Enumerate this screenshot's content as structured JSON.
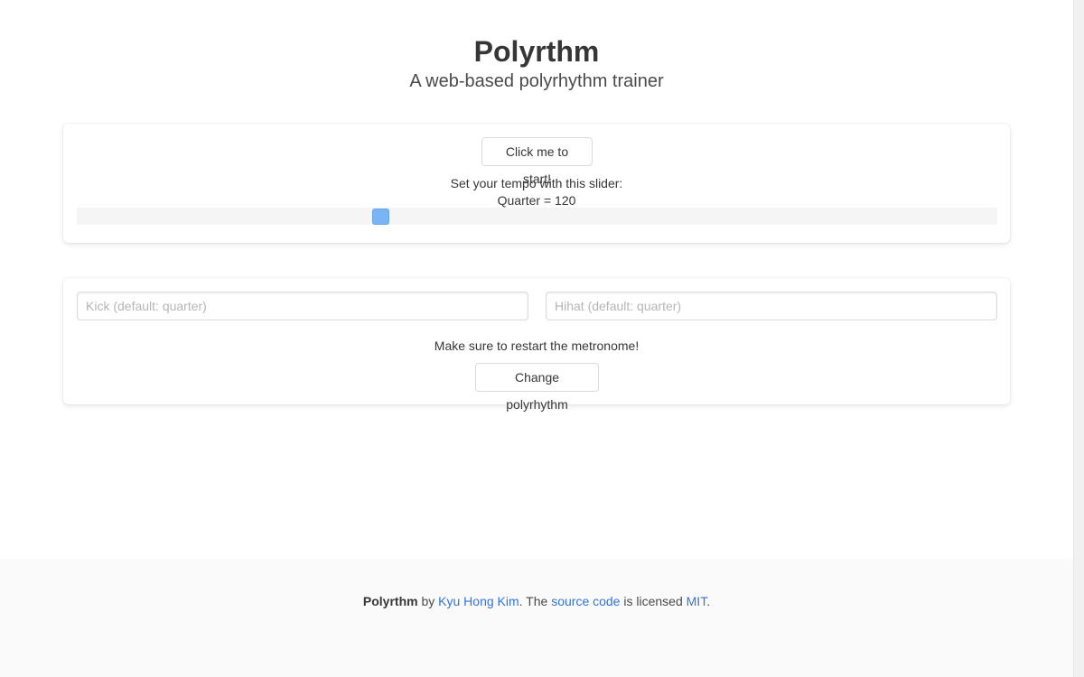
{
  "hero": {
    "title": "Polyrthm",
    "subtitle": "A web-based polyrhythm trainer"
  },
  "tempo_panel": {
    "start_button_label": "Click me to start!",
    "slider_instruction": "Set your tempo with this slider:",
    "tempo_readout": "Quarter = 120",
    "slider_value_fraction": 0.33,
    "slider_thumb_color": "#7ab4f5"
  },
  "rhythm_panel": {
    "kick_placeholder": "Kick (default: quarter)",
    "hihat_placeholder": "Hihat (default: quarter)",
    "restart_note": "Make sure to restart the metronome!",
    "change_button_label": "Change polyrhythm"
  },
  "footer": {
    "app_name": "Polyrthm",
    "by_text": " by ",
    "author_link": "Kyu Hong Kim",
    "mid_text": ". The ",
    "source_link": "source code",
    "licensed_text": " is licensed ",
    "license_link": "MIT",
    "end_text": "."
  },
  "colors": {
    "link": "#3273dc",
    "text": "#363636",
    "footer_background": "#fafafa"
  }
}
